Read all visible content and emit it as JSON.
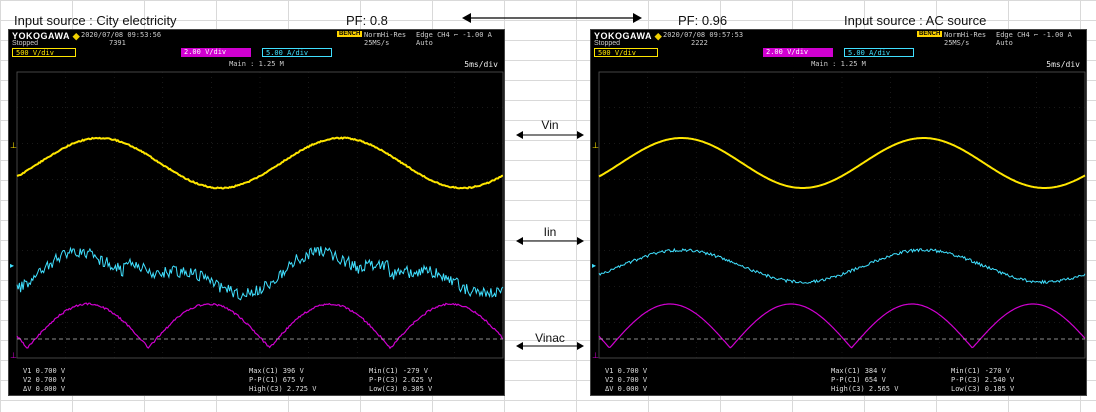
{
  "headers": {
    "left_source": "Input source : City electricity",
    "left_pf": "PF: 0.8",
    "right_pf": "PF: 0.96",
    "right_source": "Input source : AC source"
  },
  "labels": {
    "vin": "Vin",
    "iin": "Iin",
    "vinac": "Vinac"
  },
  "colors": {
    "ch1": "#ffe600",
    "ch3": "#d000d0",
    "ch4": "#40e0ff",
    "screen": "#000000"
  },
  "scopes": [
    {
      "brand": "YOKOGAWA",
      "status": "Stopped",
      "date": "2020/07/08 09:53:56",
      "count": "7391",
      "bench": "BENCH",
      "mode": "NormHi-Res",
      "rate": "25MS/s",
      "trigger": "Edge CH4 ⌐ -1.00 A",
      "auto": "Auto",
      "ch1": "500 V/div",
      "ch3": "2.00 V/div",
      "ch4": "5.00 A/div",
      "main": "Main : 1.25 M",
      "tdiv": "5ms/div",
      "meas": {
        "v1": "V1   0.700 V",
        "v2": "V2   0.700 V",
        "dv": "ΔV   0.000 V",
        "max": "Max(C1)   396 V",
        "pp1": "P-P(C1)   675 V",
        "high": "High(C3)  2.725 V",
        "min": "Min(C1)  -279 V",
        "pp3": "P-P(C3)  2.625 V",
        "low": "Low(C3)  0.305 V"
      }
    },
    {
      "brand": "YOKOGAWA",
      "status": "Stopped",
      "date": "2020/07/08 09:57:53",
      "count": "2222",
      "bench": "BENCH",
      "mode": "NormHi-Res",
      "rate": "25MS/s",
      "trigger": "Edge CH4 ⌐ -1.00 A",
      "auto": "Auto",
      "ch1": "500 V/div",
      "ch3": "2.00 V/div",
      "ch4": "5.00 A/div",
      "main": "Main : 1.25 M",
      "tdiv": "5ms/div",
      "meas": {
        "v1": "V1   0.700 V",
        "v2": "V2   0.700 V",
        "dv": "ΔV   0.000 V",
        "max": "Max(C1)   384 V",
        "pp1": "P-P(C1)   654 V",
        "high": "High(C3)  2.565 V",
        "min": "Min(C1)  -270 V",
        "pp3": "P-P(C3)  2.540 V",
        "low": "Low(C3)  0.185 V"
      }
    }
  ]
}
